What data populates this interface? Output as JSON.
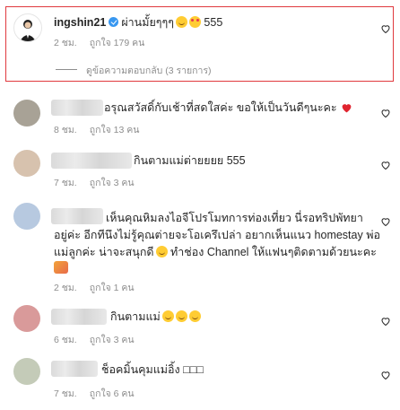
{
  "comments": [
    {
      "username": "ingshin21",
      "verified": true,
      "text": "ผ่านมั้ยๆๆๆ",
      "text_suffix": "555",
      "time": "2 ชม.",
      "likes": "ถูกใจ 179 คน",
      "view_replies": "ดูข้อความตอบกลับ (3 รายการ)"
    },
    {
      "text": "อรุณสวัสดิ์กับเช้าที่สดใสค่ะ ขอให้เป็นวันดีๆนะคะ",
      "time": "8 ชม.",
      "likes": "ถูกใจ 13 คน",
      "avatar_color": "#a8a296"
    },
    {
      "text": "กินตามแม่ต่ายยยย 555",
      "time": "7 ชม.",
      "likes": "ถูกใจ 3 คน",
      "avatar_color": "#d7c2ae"
    },
    {
      "text_line1": "เห็นคุณหิมลงไอจีโปรโมทการท่องเที่ยว นี่รอทริปพัทยา",
      "text_line2": "อยู่ค่ะ อีกทีนึงไม่รู้คุณต่ายจะโอเครึเปล่า อยากเห็นแนว homestay พ่อ",
      "text_line3": "แม่ลูกค่ะ น่าจะสนุกดี",
      "text_line3b": "ทำช่อง Channel ให้แฟนๆติดตามด้วยนะคะ",
      "time": "2 ชม.",
      "likes": "ถูกใจ 1 คน",
      "avatar_color": "#b7c9e0"
    },
    {
      "text": "กินตามแม่",
      "time": "6 ชม.",
      "likes": "ถูกใจ 3 คน",
      "avatar_color": "#d99a9a"
    },
    {
      "text": "ช็อคมิ้นคุมแม่อิ้ง",
      "text_suffix": "□□□",
      "time": "7 ชม.",
      "likes": "ถูกใจ 6 คน",
      "avatar_color": "#c4cbb8"
    }
  ],
  "colors": {
    "highlight": "#e0393e",
    "secondary_text": "#8e8e8e",
    "verified": "#3897f0"
  }
}
